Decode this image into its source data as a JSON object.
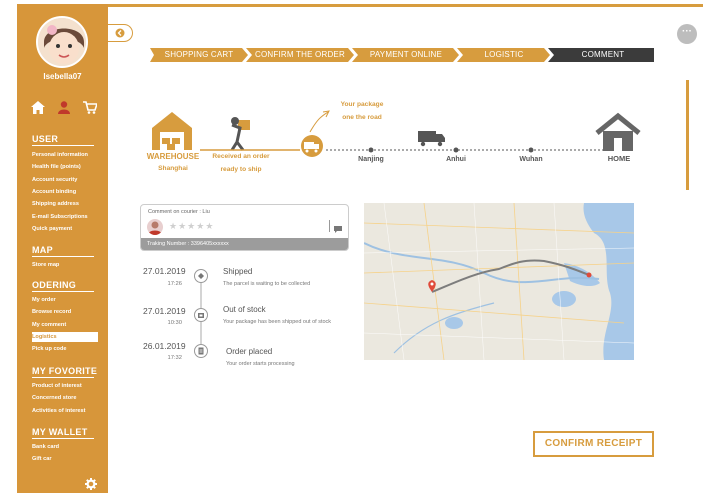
{
  "user": {
    "name": "Isebella07"
  },
  "sidebar": {
    "sections": [
      {
        "title": "USER",
        "items": [
          "Personal information",
          "Health file (points)",
          "Account security",
          "Account binding",
          "Shipping address",
          "E-mail Subscriptions",
          "Quick payment"
        ]
      },
      {
        "title": "MAP",
        "items": [
          "Store map"
        ]
      },
      {
        "title": "ODERING",
        "items": [
          "My order",
          "Browse record",
          "My comment",
          "Logistics",
          "Pick up code"
        ]
      },
      {
        "title": "MY FOVORITE",
        "items": [
          "Product of interest",
          "Concerned store",
          "Activities of interest"
        ]
      },
      {
        "title": "MY WALLET",
        "items": [
          "Bank card",
          "Gift car"
        ]
      }
    ],
    "active_item": "Logistics"
  },
  "steps": [
    "SHOPPING CART",
    "CONFIRM THE ORDER",
    "PAYMENT ONLINE",
    "LOGISTIC",
    "COMMENT"
  ],
  "tracking": {
    "warehouse_title": "WAREHOUSE",
    "warehouse_city": "Shanghai",
    "received_line1": "Received an order",
    "received_line2": "ready to ship",
    "package_line1": "Your package",
    "package_line2": "one the road",
    "cities": [
      "Nanjing",
      "Anhui",
      "Wuhan"
    ],
    "home": "HOME"
  },
  "comment": {
    "title": "Comment on courier : Liu",
    "tracking": "Traking Number : 3396405xxxxxx"
  },
  "timeline": [
    {
      "date": "27.01.2019",
      "time": "17:26",
      "title": "Shipped",
      "desc": "The parcel is waiting to be collected"
    },
    {
      "date": "27.01.2019",
      "time": "10:30",
      "title": "Out of stock",
      "desc": "Your package has been shipped out of stock"
    },
    {
      "date": "26.01.2019",
      "time": "17:32",
      "title": "Order placed",
      "desc": "Your order starts processing"
    }
  ],
  "confirm_label": "CONFIRM RECEIPT",
  "colors": {
    "accent": "#d79c3e",
    "sidebar": "#d7963a",
    "step_active": "#1e1e1e"
  }
}
